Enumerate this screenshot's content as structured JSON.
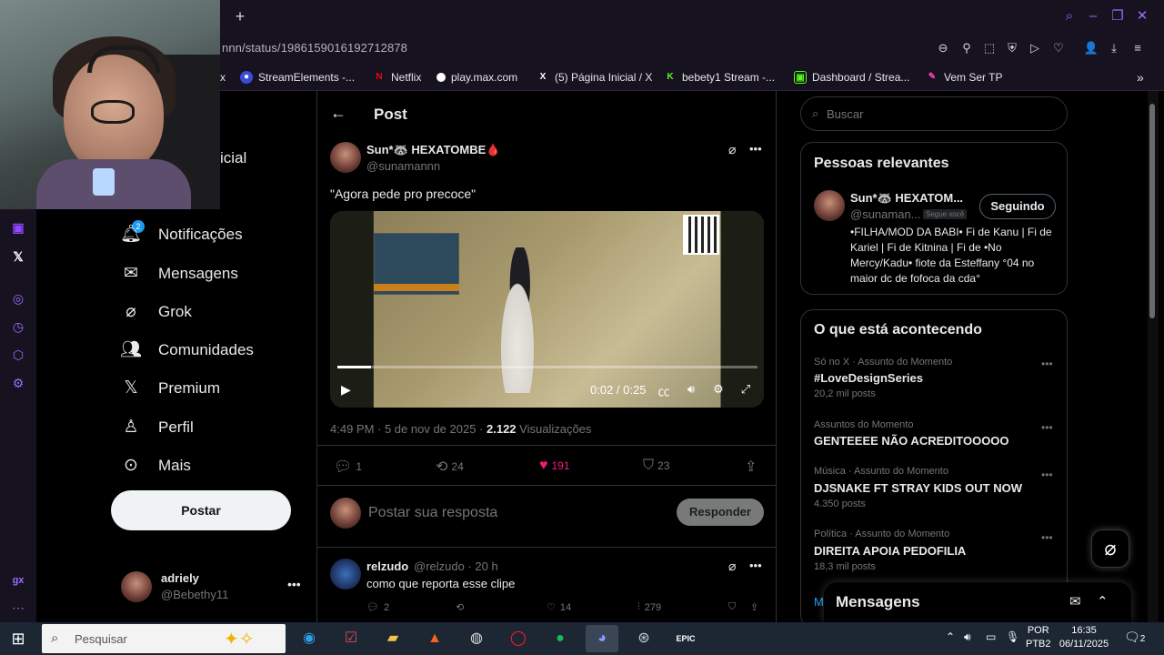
{
  "browser": {
    "url": "nnn/status/1986159016192712878",
    "bookmarks": [
      {
        "label": "x"
      },
      {
        "label": "StreamElements -..."
      },
      {
        "label": "Netflix"
      },
      {
        "label": "play.max.com"
      },
      {
        "label": "(5) Página Inicial / X"
      },
      {
        "label": "bebety1 Stream -..."
      },
      {
        "label": "Dashboard / Strea..."
      },
      {
        "label": "Vem Ser TP"
      }
    ]
  },
  "nav": {
    "partial_home": "icial",
    "notif_badge": "2",
    "items": [
      {
        "label": "Notificações"
      },
      {
        "label": "Mensagens"
      },
      {
        "label": "Grok"
      },
      {
        "label": "Comunidades"
      },
      {
        "label": "Premium"
      },
      {
        "label": "Perfil"
      },
      {
        "label": "Mais"
      }
    ],
    "post_button": "Postar",
    "account": {
      "name": "adriely",
      "handle": "@Bebethy11"
    }
  },
  "post": {
    "header_title": "Post",
    "author": "Sun*🦝 HEXATOMBE🩸",
    "handle": "@sunamannn",
    "text": "\"Agora pede pro precoce\"",
    "video": {
      "time": "0:02 / 0:25",
      "progress": 0.08
    },
    "meta_time": "4:49 PM · 5 de nov de 2025 · ",
    "views_count": "2.122",
    "views_label": " Visualizações",
    "actions": {
      "replies": "1",
      "reposts": "24",
      "likes": "191",
      "bookmarks": "23"
    },
    "reply_placeholder": "Postar sua resposta",
    "reply_button": "Responder"
  },
  "reply": {
    "name": "relzudo",
    "handle": "@relzudo · 20 h",
    "text": "como que reporta esse clipe",
    "actions": {
      "replies": "2",
      "likes": "14",
      "views": "279"
    }
  },
  "right": {
    "search_placeholder": "Buscar",
    "relevant": {
      "title": "Pessoas relevantes",
      "name": "Sun*🦝 HEXATOM...",
      "handle": "@sunaman...",
      "follows_you": "Segue você",
      "follow_button": "Seguindo",
      "bio": "•FILHA/MOD DA BABI• Fi de Kanu | Fi de Kariel | Fi de Kitnina | Fi de •No Mercy/Kadu• fiote da Esteffany °04 no maior dc de fofoca da cda°"
    },
    "trends": {
      "title": "O que está acontecendo",
      "items": [
        {
          "category": "Só no X · Assunto do Momento",
          "name": "#LoveDesignSeries",
          "posts": "20,2 mil posts"
        },
        {
          "category": "Assuntos do Momento",
          "name": "GENTEEEE NÃO ACREDITOOOOO",
          "posts": ""
        },
        {
          "category": "Música · Assunto do Momento",
          "name": "DJSNAKE FT STRAY KIDS OUT NOW",
          "posts": "4.350 posts"
        },
        {
          "category": "Política · Assunto do Momento",
          "name": "DIREITA APOIA PEDOFILIA",
          "posts": "18,3 mil posts"
        }
      ]
    },
    "messages_title": "Mensagens",
    "messages_partial": "M"
  },
  "taskbar": {
    "search_placeholder": "Pesquisar",
    "lang": "POR",
    "lang2": "PTB2",
    "time": "16:35",
    "date": "06/11/2025",
    "notif_count": "2"
  },
  "colors": {
    "like": "#f91880",
    "accent": "#1d9bf0",
    "opera": "#9b6cff"
  }
}
